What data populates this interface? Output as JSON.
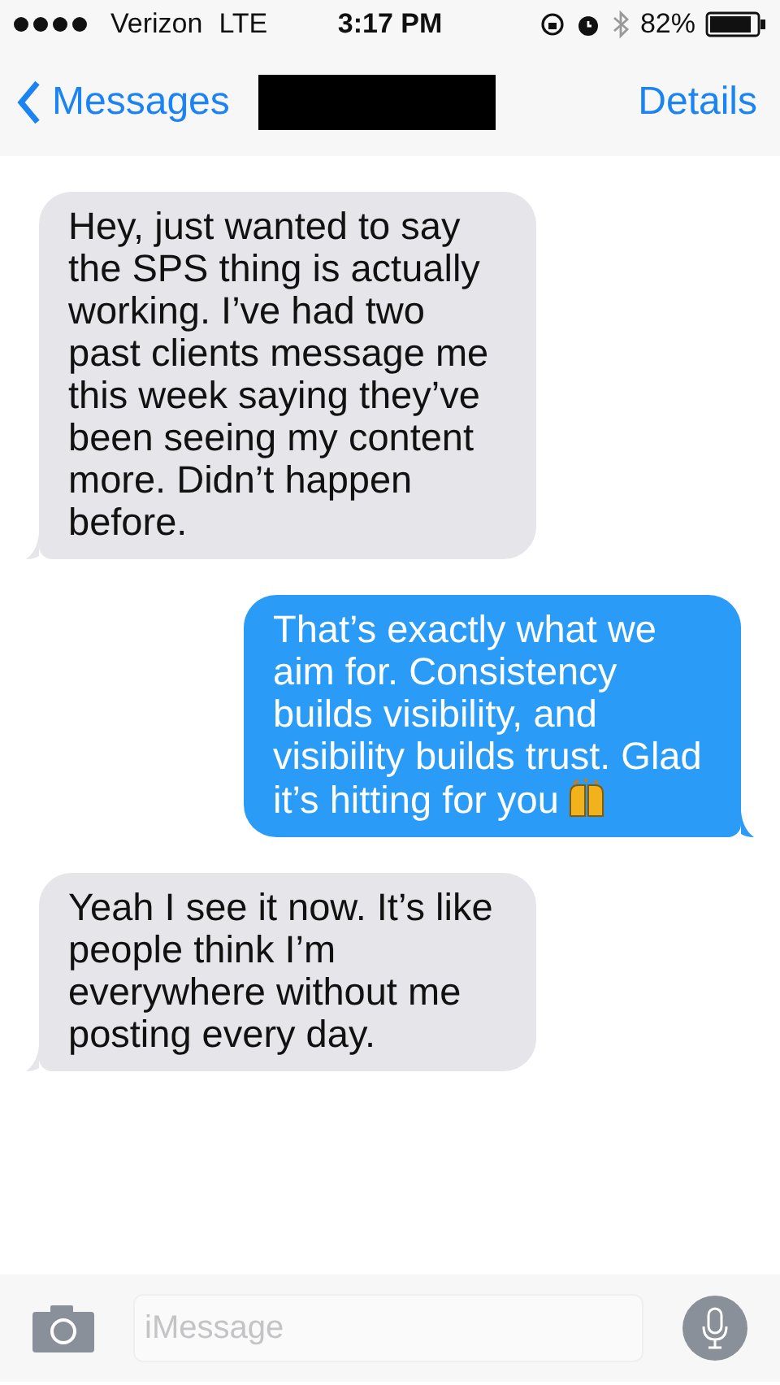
{
  "status_bar": {
    "carrier": "Verizon",
    "network": "LTE",
    "time": "3:17 PM",
    "battery": "82%"
  },
  "nav": {
    "back": "Messages",
    "action": "Details"
  },
  "messages": [
    {
      "kind": "incoming",
      "text": "Hey, just wanted to say the SPS thing is actually working. I’ve had two past clients message me this week saying they’ve been seeing my content more. Didn’t happen before."
    },
    {
      "kind": "outgoing",
      "text": "That’s exactly what we aim for. Consistency builds visibility, and visibility builds trust. Glad it’s hitting for you",
      "emoji": true
    },
    {
      "kind": "incoming",
      "text": "Yeah I see it now. It’s like people think I’m everywhere without me posting every day."
    }
  ],
  "composer": {
    "placeholder": "iMessage"
  }
}
